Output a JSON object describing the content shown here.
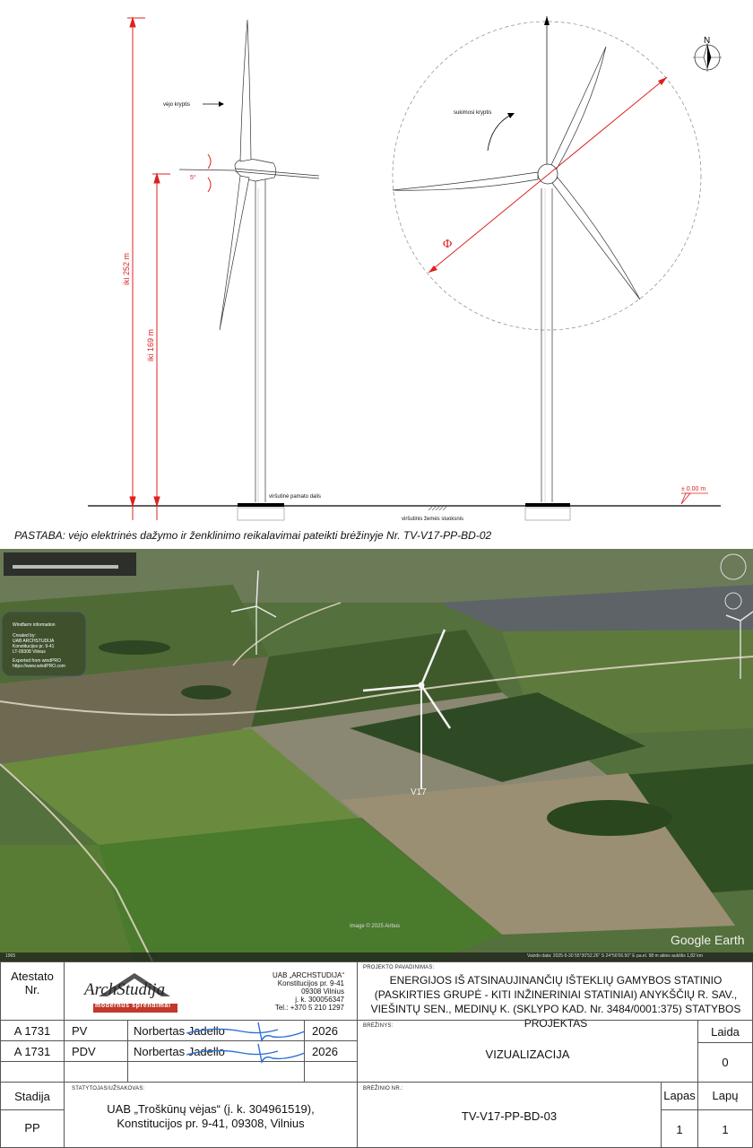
{
  "drawing": {
    "labels": {
      "wind_direction": "vėjo kryptis",
      "rotation_direction": "sukimosi kryptis",
      "tilt_angle": "5°",
      "total_height": "iki 252 m",
      "hub_height": "iki 169 m",
      "foundation": "viršutinė pamato dalis",
      "ground_layer": "viršutinis žemės sluoksnis",
      "zero_level": "± 0.00 m",
      "diameter_symbol": "Φ",
      "north": "N"
    },
    "note": "PASTABA: vėjo elektrinės dažymo ir ženklinimo reikalavimai pateikti brėžinyje Nr. TV-V17-PP-BD-02"
  },
  "aerial": {
    "turbine_label": "V17",
    "info_box": {
      "title": "Windfarm information",
      "created_by": "Created by:",
      "company": "UAB ARCHSTUDIJA",
      "address": "Konstitucijos pr. 9-41",
      "postal": "LT-09308 Vilnius",
      "exported": "Exported from windPRO",
      "url": "https://www.windPRO.com"
    },
    "image_credit": "Image © 2025 Airbus",
    "status_bar": "Vaizdo data: 2025-5-30    55°30'52.26\" S    24°56'06.50\" E   pa.el.  98 m    akies aukštis  1,82 km",
    "brand": "Google Earth",
    "scale_badge": "1965"
  },
  "title_block": {
    "atestato_label": "Atestato\nNr.",
    "company_name": "UAB „ARCHSTUDIJA“",
    "company_address": "Konstitucijos pr. 9-41",
    "company_city": "09308 Vilnius",
    "company_code": "j. k. 300056347",
    "company_phone": "Tel.: +370 5 210 1297",
    "logo_text": "ArchStudija",
    "logo_tagline": "modernūs sprendimai",
    "project_label": "PROJEKTO PAVADINIMAS:",
    "project_name": "ENERGIJOS IŠ ATSINAUJINANČIŲ IŠTEKLIŲ GAMYBOS STATINIO (PASKIRTIES GRUPĖ - KITI INŽINERINIAI STATINIAI) ANYKŠČIŲ R. SAV., VIEŠINTŲ SEN., MEDINŲ K. (SKLYPO KAD. Nr. 3484/0001:375) STATYBOS PROJEKTAS",
    "rows": [
      {
        "cert": "A 1731",
        "role": "PV",
        "name": "Norbertas Jadello",
        "year": "2026"
      },
      {
        "cert": "A 1731",
        "role": "PDV",
        "name": "Norbertas Jadello",
        "year": "2026"
      }
    ],
    "drawing_label": "BRĖŽINYS:",
    "drawing_name": "VIZUALIZACIJA",
    "laida_label": "Laida",
    "laida_value": "0",
    "stadija_label": "Stadija",
    "stadija_value": "PP",
    "client_label": "STATYTOJAS/UŽSAKOVAS:",
    "client_name": "UAB „Troškūnų vėjas“ (į. k. 304961519),",
    "client_address": "Konstitucijos pr. 9-41, 09308, Vilnius",
    "drawing_no_label": "BRĖŽINIO NR.:",
    "drawing_no": "TV-V17-PP-BD-03",
    "lapas_label": "Lapas",
    "lapas_value": "1",
    "lapu_label": "Lapų",
    "lapu_value": "1"
  },
  "colors": {
    "dimension_red": "#e02020",
    "signature_blue": "#2a6fd6",
    "logo_red": "#c0392b"
  }
}
